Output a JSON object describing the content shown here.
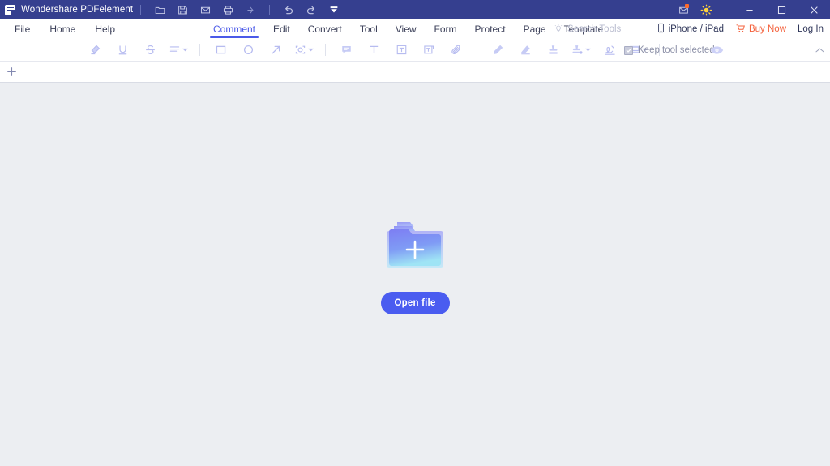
{
  "titlebar": {
    "app_name": "Wondershare PDFelement",
    "quick_actions": [
      {
        "name": "open-folder-icon",
        "label": "Open"
      },
      {
        "name": "save-icon",
        "label": "Save"
      },
      {
        "name": "email-icon",
        "label": "Email"
      },
      {
        "name": "print-icon",
        "label": "Print"
      },
      {
        "name": "share-icon",
        "label": "Share"
      }
    ],
    "history_actions": [
      {
        "name": "undo-icon",
        "label": "Undo"
      },
      {
        "name": "redo-icon",
        "label": "Redo"
      },
      {
        "name": "customize-toolbar-icon",
        "label": "Customize Quick Access Toolbar"
      }
    ],
    "right_icons": [
      {
        "name": "message-icon",
        "label": "Messages",
        "badge": true
      },
      {
        "name": "theme-sun-icon",
        "label": "Theme"
      }
    ],
    "window_controls": [
      {
        "name": "minimize-button",
        "label": "Minimize"
      },
      {
        "name": "maximize-button",
        "label": "Maximize"
      },
      {
        "name": "close-button",
        "label": "Close"
      }
    ],
    "colors": {
      "background": "#353f8f",
      "badge": "#ff6a2b"
    }
  },
  "menubar": {
    "left_items": [
      {
        "label": "File"
      },
      {
        "label": "Home"
      },
      {
        "label": "Help"
      }
    ],
    "tabs": [
      {
        "label": "Comment",
        "active": true
      },
      {
        "label": "Edit",
        "active": false
      },
      {
        "label": "Convert",
        "active": false
      },
      {
        "label": "Tool",
        "active": false
      },
      {
        "label": "View",
        "active": false
      },
      {
        "label": "Form",
        "active": false
      },
      {
        "label": "Protect",
        "active": false
      },
      {
        "label": "Page",
        "active": false
      },
      {
        "label": "Template",
        "active": false
      }
    ],
    "search": {
      "placeholder": "Search Tools",
      "icon": "lightbulb-icon"
    },
    "right_items": [
      {
        "label": "iPhone / iPad",
        "icon": "phone-icon",
        "style": "normal"
      },
      {
        "label": "Buy Now",
        "icon": "cart-icon",
        "style": "accent"
      },
      {
        "label": "Log In",
        "icon": "",
        "style": "normal"
      }
    ],
    "accent_color": "#4b5ae8",
    "buy_color": "#f4613c"
  },
  "toolbar": {
    "groups": [
      {
        "tools": [
          {
            "name": "highlight-tool",
            "label": "Highlight",
            "caret": false
          },
          {
            "name": "underline-tool",
            "label": "Underline",
            "caret": false
          },
          {
            "name": "strikethrough-tool",
            "label": "Strikethrough",
            "caret": false
          },
          {
            "name": "squiggly-tool",
            "label": "Squiggly Line",
            "caret": true
          }
        ]
      },
      {
        "tools": [
          {
            "name": "rectangle-tool",
            "label": "Rectangle",
            "caret": false
          },
          {
            "name": "oval-tool",
            "label": "Oval",
            "caret": false
          },
          {
            "name": "arrow-tool",
            "label": "Arrow",
            "caret": false
          },
          {
            "name": "shapes-tool",
            "label": "Shapes",
            "caret": true
          }
        ]
      },
      {
        "tools": [
          {
            "name": "note-tool",
            "label": "Note",
            "caret": false
          },
          {
            "name": "typewriter-tool",
            "label": "Typewriter",
            "caret": false
          },
          {
            "name": "text-box-tool",
            "label": "Text Box",
            "caret": false
          },
          {
            "name": "text-callout-tool",
            "label": "Text Callout",
            "caret": false
          },
          {
            "name": "attachment-tool",
            "label": "Attachment",
            "caret": false
          }
        ]
      },
      {
        "tools": [
          {
            "name": "pencil-tool",
            "label": "Pencil",
            "caret": false
          },
          {
            "name": "eraser-tool",
            "label": "Eraser",
            "caret": false
          },
          {
            "name": "stamp-tool",
            "label": "Stamp",
            "caret": false
          },
          {
            "name": "custom-stamp-tool",
            "label": "Custom Stamp",
            "caret": true
          },
          {
            "name": "signature-tool",
            "label": "Signature",
            "caret": false
          },
          {
            "name": "area-highlight-tool",
            "label": "Area Highlight",
            "caret": true
          }
        ]
      }
    ],
    "keep_tool": {
      "label": "Keep tool selected",
      "checked": true
    },
    "eye_icon": "hide-comments-icon",
    "collapse_icon": "chevron-up-icon"
  },
  "tabstrip": {
    "new_tab_label": "+"
  },
  "canvas": {
    "folder_icon": "add-file-folder-icon",
    "open_file_label": "Open file",
    "button_color": "#4a5cf0",
    "background_color": "#eceef2"
  }
}
